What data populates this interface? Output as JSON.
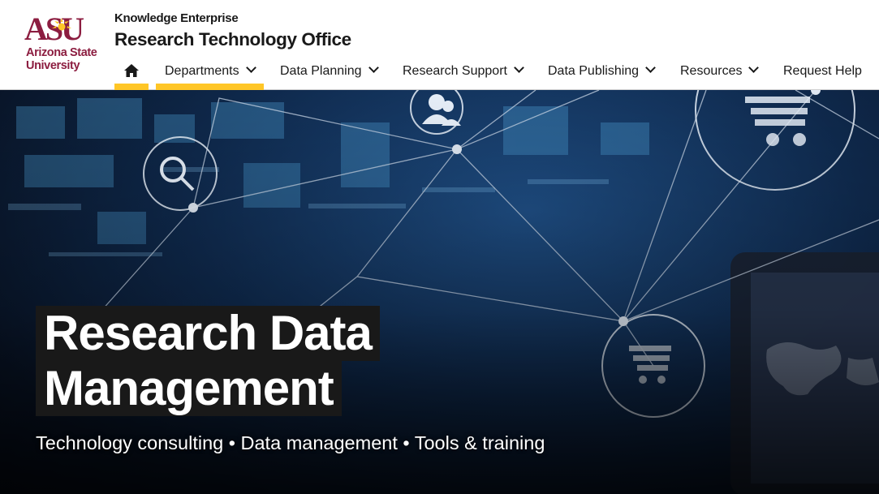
{
  "brand": {
    "logo_text": "ASU",
    "university_name_line1": "Arizona State",
    "university_name_line2": "University",
    "maroon": "#8c1d40",
    "gold": "#ffc627"
  },
  "header": {
    "subtitle": "Knowledge Enterprise",
    "title": "Research Technology Office"
  },
  "nav": {
    "home_icon": "home-icon",
    "items": [
      {
        "label": "Departments",
        "dropdown": true,
        "active": true
      },
      {
        "label": "Data Planning",
        "dropdown": true
      },
      {
        "label": "Research Support",
        "dropdown": true
      },
      {
        "label": "Data Publishing",
        "dropdown": true
      },
      {
        "label": "Resources",
        "dropdown": true
      },
      {
        "label": "Request Help",
        "dropdown": false
      }
    ]
  },
  "hero": {
    "headline_line1": "Research Data",
    "headline_line2": "Management",
    "tagline": "Technology consulting • Data management • Tools & training",
    "icons": [
      "user-group-icon",
      "search-icon",
      "shopping-cart-icon",
      "shopping-cart-icon",
      "world-map-icon"
    ]
  }
}
